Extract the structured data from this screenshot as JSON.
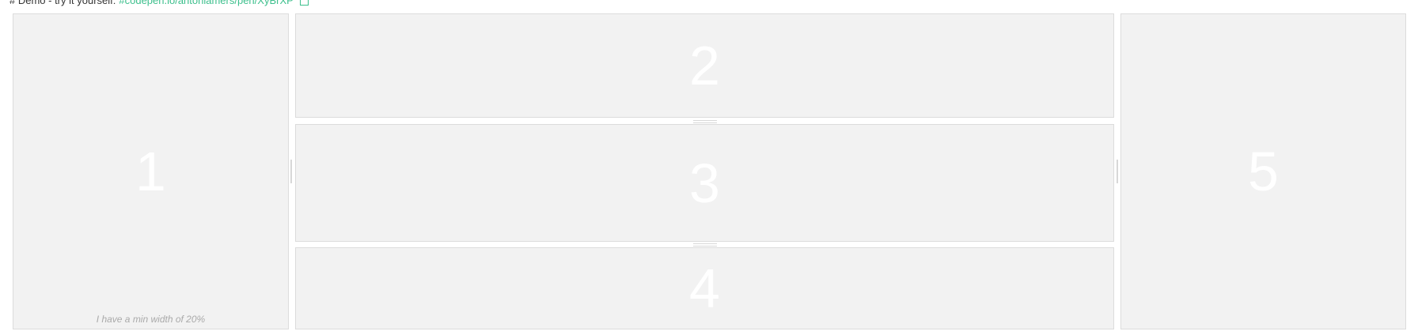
{
  "demo": {
    "prefix": "# Demo - try it yourself: ",
    "link": "#codepen.io/antonlamers/pen/XyBrXP"
  },
  "panes": {
    "p1": {
      "label": "1",
      "note": "I have a min width of 20%"
    },
    "p2": {
      "label": "2"
    },
    "p3": {
      "label": "3"
    },
    "p4": {
      "label": "4"
    },
    "p5": {
      "label": "5"
    }
  },
  "colors": {
    "pane_bg": "#f2f2f2",
    "pane_border": "#dcdcdc",
    "link": "#3cbf8c",
    "number": "#ffffff"
  }
}
